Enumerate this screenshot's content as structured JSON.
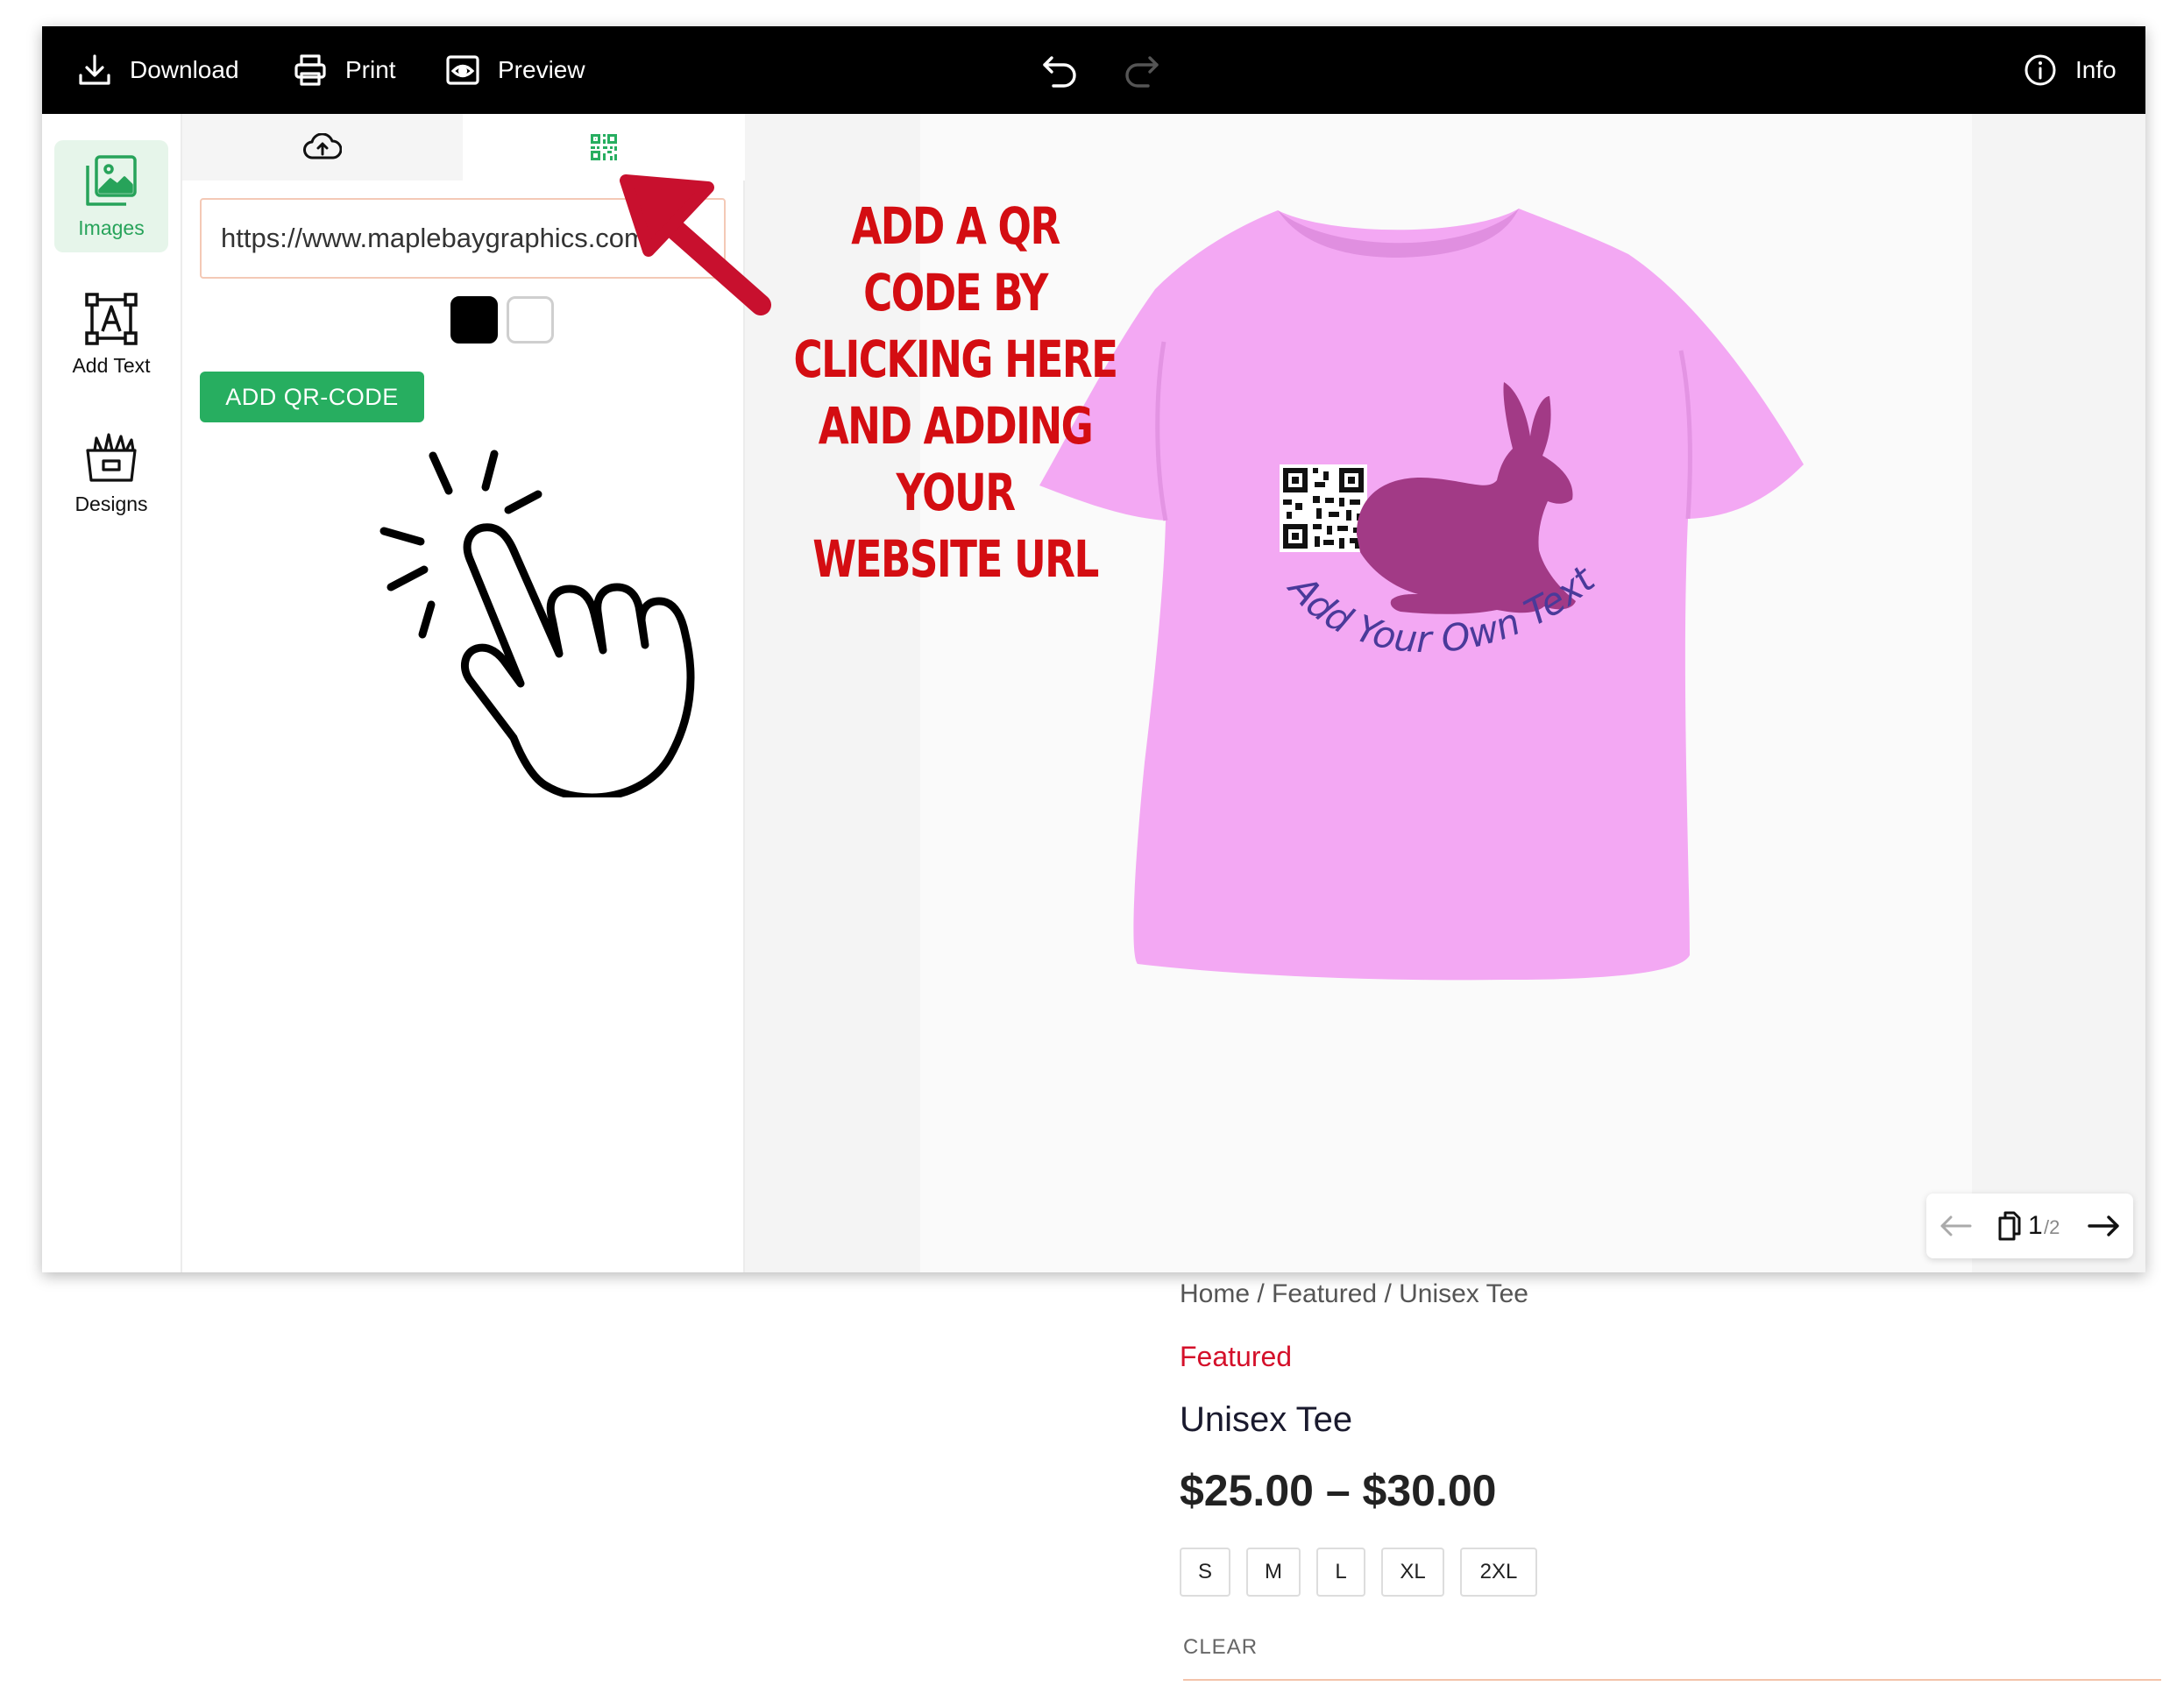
{
  "toolbar": {
    "download_label": "Download",
    "print_label": "Print",
    "preview_label": "Preview",
    "info_label": "Info"
  },
  "sidebar": {
    "items": [
      {
        "label": "Images",
        "icon": "images-icon"
      },
      {
        "label": "Add Text",
        "icon": "add-text-icon"
      },
      {
        "label": "Designs",
        "icon": "designs-icon"
      }
    ]
  },
  "panel": {
    "tabs": [
      {
        "icon": "cloud-upload-icon"
      },
      {
        "icon": "qr-code-icon"
      }
    ],
    "url_value": "https://www.maplebaygraphics.com",
    "swatches": [
      "#000000",
      "#ffffff"
    ],
    "add_button_label": "ADD QR-CODE"
  },
  "annotation": {
    "lines": [
      "ADD A QR CODE BY",
      "CLICKING HERE",
      "AND ADDING YOUR",
      "WEBSITE URL"
    ],
    "color": "#d40d12"
  },
  "canvas": {
    "shirt_color": "#f3a8f3",
    "curved_text": "Add Your Own Text",
    "rabbit_color": "#a23a86",
    "text_color": "#4a3a9a"
  },
  "pager": {
    "current": "1",
    "total": "/2"
  },
  "product": {
    "breadcrumb": "Home / Featured / Unisex Tee",
    "category": "Featured",
    "title": "Unisex Tee",
    "price": "$25.00 – $30.00",
    "sizes": [
      "S",
      "M",
      "L",
      "XL",
      "2XL"
    ],
    "clear_label": "CLEAR"
  },
  "colors": {
    "accent": "#27ae60",
    "topbar": "#000000"
  }
}
